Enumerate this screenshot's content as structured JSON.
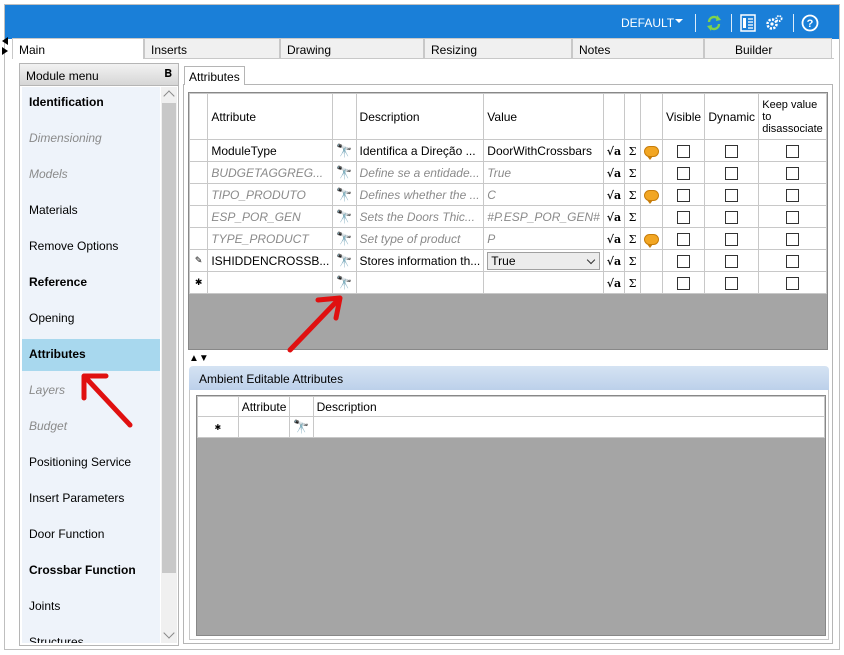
{
  "topbar": {
    "profile": "DEFAULT",
    "colors": {
      "bar": "#1a7fd8"
    }
  },
  "tabs": [
    {
      "label": "Main",
      "active": true
    },
    {
      "label": "Inserts",
      "active": false
    },
    {
      "label": "Drawing",
      "active": false
    },
    {
      "label": "Resizing",
      "active": false
    },
    {
      "label": "Notes",
      "active": false
    },
    {
      "label": "Builder",
      "active": false
    }
  ],
  "module_menu": {
    "title": "Module menu",
    "items": [
      {
        "label": "Identification",
        "style": "bold"
      },
      {
        "label": "Dimensioning",
        "style": "disabled"
      },
      {
        "label": "Models",
        "style": "disabled"
      },
      {
        "label": "Materials",
        "style": "normal"
      },
      {
        "label": "Remove Options",
        "style": "normal"
      },
      {
        "label": "Reference",
        "style": "bold"
      },
      {
        "label": "Opening",
        "style": "normal"
      },
      {
        "label": "Attributes",
        "style": "bold-selected"
      },
      {
        "label": "Layers",
        "style": "disabled"
      },
      {
        "label": "Budget",
        "style": "disabled"
      },
      {
        "label": "Positioning Service",
        "style": "normal"
      },
      {
        "label": "Insert Parameters",
        "style": "normal"
      },
      {
        "label": "Door Function",
        "style": "normal"
      },
      {
        "label": "Crossbar Function",
        "style": "bold"
      },
      {
        "label": "Joints",
        "style": "normal"
      },
      {
        "label": "Structures",
        "style": "normal"
      }
    ]
  },
  "attributes": {
    "tab_label": "Attributes",
    "columns": {
      "attribute": "Attribute",
      "description": "Description",
      "value": "Value",
      "visible": "Visible",
      "dynamic": "Dynamic",
      "keep": "Keep value to disassociate"
    },
    "rows": [
      {
        "marker": "",
        "attribute": "ModuleType",
        "description": "Identifica a Direção ...",
        "value": "DoorWithCrossbars",
        "italic": false,
        "bubble": true
      },
      {
        "marker": "",
        "attribute": "BUDGETAGGREG...",
        "description": "Define se a entidade...",
        "value": "True",
        "italic": true,
        "bubble": false
      },
      {
        "marker": "",
        "attribute": "TIPO_PRODUTO",
        "description": "Defines whether the ...",
        "value": "C",
        "italic": true,
        "bubble": true
      },
      {
        "marker": "",
        "attribute": "ESP_POR_GEN",
        "description": "Sets the Doors Thic...",
        "value": "#P.ESP_POR_GEN#",
        "italic": true,
        "bubble": false
      },
      {
        "marker": "",
        "attribute": "TYPE_PRODUCT",
        "description": "Set type of product",
        "value": "P",
        "italic": true,
        "bubble": true
      },
      {
        "marker": "✎",
        "attribute": "ISHIDDENCROSSB...",
        "description": "Stores information th...",
        "value": "True",
        "italic": false,
        "bubble": false,
        "dropdown": true
      },
      {
        "marker": "✱",
        "attribute": "",
        "description": "",
        "value": "",
        "italic": false,
        "bubble": false,
        "new_row": true
      }
    ]
  },
  "ambient": {
    "title": "Ambient Editable Attributes",
    "columns": {
      "attribute": "Attribute",
      "description": "Description"
    },
    "new_row_marker": "✱"
  },
  "glyphs": {
    "binoculars": "🔭",
    "sigma": "Σ",
    "sqrt": "√a",
    "pin": "ꟸ"
  }
}
